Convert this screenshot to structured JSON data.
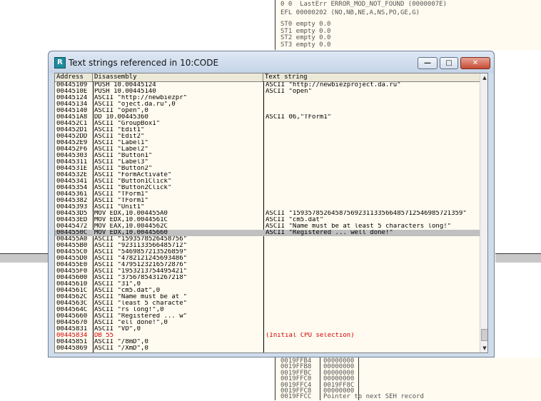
{
  "background": {
    "registers": [
      "0 0  LastErr ERROR_MOD_NOT_FOUND (0000007E)",
      "EFL 00000202 (NO,NB,NE,A,NS,PO,GE,G)",
      "",
      "ST0 empty 0.0",
      "ST1 empty 0.0",
      "ST2 empty 0.0",
      "ST3 empty 0.0"
    ],
    "stack": [
      [
        "0019FFB4",
        "00000000"
      ],
      [
        "0019FFB8",
        "00000000"
      ],
      [
        "0019FFBC",
        "00000000"
      ],
      [
        "0019FFC0",
        "00000000"
      ],
      [
        "0019FFC4",
        "0019FF8C"
      ],
      [
        "0019FFC8",
        "00000000"
      ],
      [
        "0019FFCC",
        "Pointer to next SEH record"
      ]
    ]
  },
  "window": {
    "icon_letter": "R",
    "title": "Text strings referenced in 10:CODE",
    "buttons": {
      "minimize": "—",
      "maximize": "□",
      "close": "✕"
    }
  },
  "table": {
    "headers": {
      "address": "Address",
      "disassembly": "Disassembly",
      "text": "Text string"
    },
    "rows": [
      {
        "addr": "00445109",
        "dis": "PUSH 10.00445124",
        "txt": "ASCII \"http://newbiezproject.da.ru\""
      },
      {
        "addr": "0044510E",
        "dis": "PUSH 10.00445140",
        "txt": "ASCII \"open\""
      },
      {
        "addr": "00445124",
        "dis": "ASCII \"http://newbiezpr\"",
        "txt": ""
      },
      {
        "addr": "00445134",
        "dis": "ASCII \"oject.da.ru\",0",
        "txt": ""
      },
      {
        "addr": "00445140",
        "dis": "ASCII \"open\",0",
        "txt": ""
      },
      {
        "addr": "004451A8",
        "dis": "DD 10.00445360",
        "txt": "ASCII 06,\"TForm1\""
      },
      {
        "addr": "004452C1",
        "dis": "ASCII \"GroupBox1\"",
        "txt": ""
      },
      {
        "addr": "004452D1",
        "dis": "ASCII \"Edit1\"",
        "txt": ""
      },
      {
        "addr": "004452DD",
        "dis": "ASCII \"Edit2\"",
        "txt": ""
      },
      {
        "addr": "004452E9",
        "dis": "ASCII \"Label1\"",
        "txt": ""
      },
      {
        "addr": "004452F6",
        "dis": "ASCII \"Label2\"",
        "txt": ""
      },
      {
        "addr": "00445303",
        "dis": "ASCII \"Button1\"",
        "txt": ""
      },
      {
        "addr": "00445311",
        "dis": "ASCII \"Label3\"",
        "txt": ""
      },
      {
        "addr": "0044531E",
        "dis": "ASCII \"Button2\"",
        "txt": ""
      },
      {
        "addr": "0044532E",
        "dis": "ASCII \"FormActivate\"",
        "txt": ""
      },
      {
        "addr": "00445341",
        "dis": "ASCII \"Button1Click\"",
        "txt": ""
      },
      {
        "addr": "00445354",
        "dis": "ASCII \"Button2Click\"",
        "txt": ""
      },
      {
        "addr": "00445361",
        "dis": "ASCII \"TForm1\"",
        "txt": ""
      },
      {
        "addr": "00445382",
        "dis": "ASCII \"TForm1\"",
        "txt": ""
      },
      {
        "addr": "00445393",
        "dis": "ASCII \"Unit1\"",
        "txt": ""
      },
      {
        "addr": "004453D5",
        "dis": "MOV EDX,10.004455A0",
        "txt": "ASCII \"15935785264587569231133566485712546985721359\""
      },
      {
        "addr": "004453ED",
        "dis": "MOV EDX,10.0044561C",
        "txt": "ASCII \"cm5.dat\""
      },
      {
        "addr": "00445472",
        "dis": "MOV EAX,10.0044562C",
        "txt": "ASCII \"Name must be at least 5 characters long!\""
      },
      {
        "addr": "0044550C",
        "dis": "MOV EDX,10.00445660",
        "txt": "ASCII \"Registered ... well done!\"",
        "selected": true
      },
      {
        "addr": "004455A0",
        "dis": "ASCII \"1593578526458756\"",
        "txt": ""
      },
      {
        "addr": "004455B0",
        "dis": "ASCII \"9231133566485712\"",
        "txt": ""
      },
      {
        "addr": "004455C0",
        "dis": "ASCII \"5469857213526859\"",
        "txt": ""
      },
      {
        "addr": "004455D0",
        "dis": "ASCII \"4782121245693486\"",
        "txt": ""
      },
      {
        "addr": "004455E0",
        "dis": "ASCII \"4795123216572876\"",
        "txt": ""
      },
      {
        "addr": "004455F0",
        "dis": "ASCII \"1953213754495421\"",
        "txt": ""
      },
      {
        "addr": "00445600",
        "dis": "ASCII \"3756785431267218\"",
        "txt": ""
      },
      {
        "addr": "00445610",
        "dis": "ASCII \"31\",0",
        "txt": ""
      },
      {
        "addr": "0044561C",
        "dis": "ASCII \"cm5.dat\",0",
        "txt": ""
      },
      {
        "addr": "0044562C",
        "dis": "ASCII \"Name must be at \"",
        "txt": ""
      },
      {
        "addr": "0044563C",
        "dis": "ASCII \"least 5 characte\"",
        "txt": ""
      },
      {
        "addr": "0044564C",
        "dis": "ASCII \"rs long!\",0",
        "txt": ""
      },
      {
        "addr": "00445660",
        "dis": "ASCII \"Registered ... w\"",
        "txt": ""
      },
      {
        "addr": "00445670",
        "dis": "ASCII \"ell done!\",0",
        "txt": ""
      },
      {
        "addr": "00445831",
        "dis": "ASCII \"VD\",0",
        "txt": ""
      },
      {
        "addr": "00445834",
        "dis": "DB 55",
        "txt": "(Initial CPU selection)",
        "red": true
      },
      {
        "addr": "00445851",
        "dis": "ASCII \"/8mD\",0",
        "txt": ""
      },
      {
        "addr": "00445869",
        "dis": "ASCII \"/XmD\",0",
        "txt": ""
      }
    ]
  },
  "scrollbar": {
    "up": "▲",
    "down": "▼"
  }
}
